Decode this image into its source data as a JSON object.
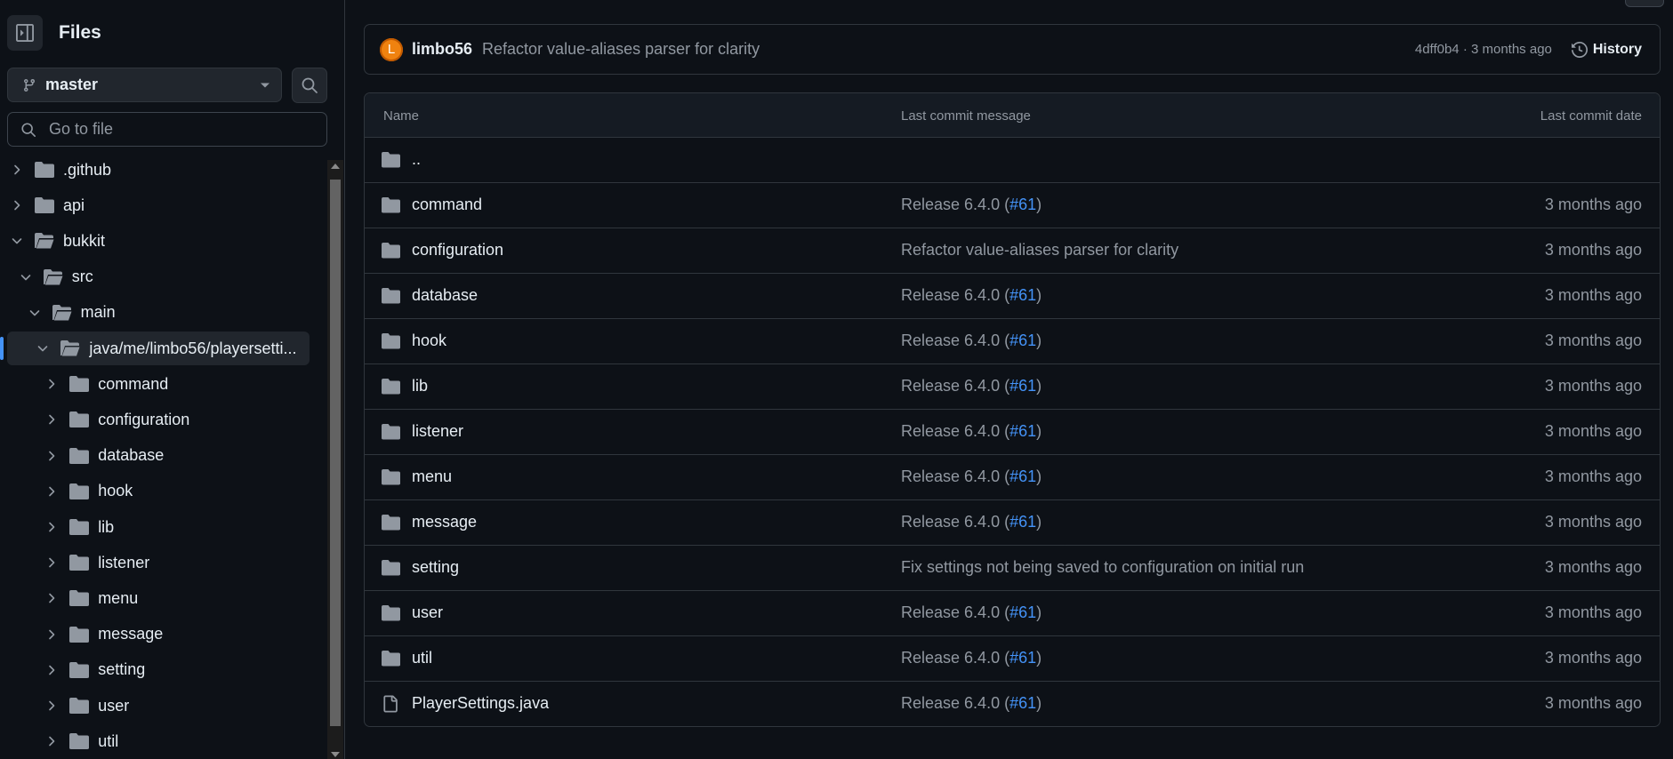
{
  "sidebar": {
    "title": "Files",
    "branch": "master",
    "goto_placeholder": "Go to file",
    "tree": [
      {
        "name": ".github",
        "depth": 0,
        "expanded": false,
        "selected": false
      },
      {
        "name": "api",
        "depth": 0,
        "expanded": false,
        "selected": false
      },
      {
        "name": "bukkit",
        "depth": 0,
        "expanded": true,
        "selected": false
      },
      {
        "name": "src",
        "depth": 1,
        "expanded": true,
        "selected": false
      },
      {
        "name": "main",
        "depth": 2,
        "expanded": true,
        "selected": false
      },
      {
        "name": "java/me/limbo56/playersetti...",
        "depth": 3,
        "expanded": true,
        "selected": true
      },
      {
        "name": "command",
        "depth": 4,
        "expanded": false,
        "selected": false
      },
      {
        "name": "configuration",
        "depth": 4,
        "expanded": false,
        "selected": false
      },
      {
        "name": "database",
        "depth": 4,
        "expanded": false,
        "selected": false
      },
      {
        "name": "hook",
        "depth": 4,
        "expanded": false,
        "selected": false
      },
      {
        "name": "lib",
        "depth": 4,
        "expanded": false,
        "selected": false
      },
      {
        "name": "listener",
        "depth": 4,
        "expanded": false,
        "selected": false
      },
      {
        "name": "menu",
        "depth": 4,
        "expanded": false,
        "selected": false
      },
      {
        "name": "message",
        "depth": 4,
        "expanded": false,
        "selected": false
      },
      {
        "name": "setting",
        "depth": 4,
        "expanded": false,
        "selected": false
      },
      {
        "name": "user",
        "depth": 4,
        "expanded": false,
        "selected": false
      },
      {
        "name": "util",
        "depth": 4,
        "expanded": false,
        "selected": false
      }
    ]
  },
  "commit": {
    "avatar_letter": "L",
    "author": "limbo56",
    "message": "Refactor value-aliases parser for clarity",
    "meta": "4dff0b4 · 3 months ago",
    "history_label": "History"
  },
  "table": {
    "headers": {
      "name": "Name",
      "message": "Last commit message",
      "date": "Last commit date"
    },
    "parent_label": "..",
    "rows": [
      {
        "name": "command",
        "type": "folder",
        "msg": "Release 6.4.0 (",
        "pr": "#61",
        "msg_end": ")",
        "date": "3 months ago"
      },
      {
        "name": "configuration",
        "type": "folder",
        "msg": "Refactor value-aliases parser for clarity",
        "pr": "",
        "msg_end": "",
        "date": "3 months ago"
      },
      {
        "name": "database",
        "type": "folder",
        "msg": "Release 6.4.0 (",
        "pr": "#61",
        "msg_end": ")",
        "date": "3 months ago"
      },
      {
        "name": "hook",
        "type": "folder",
        "msg": "Release 6.4.0 (",
        "pr": "#61",
        "msg_end": ")",
        "date": "3 months ago"
      },
      {
        "name": "lib",
        "type": "folder",
        "msg": "Release 6.4.0 (",
        "pr": "#61",
        "msg_end": ")",
        "date": "3 months ago"
      },
      {
        "name": "listener",
        "type": "folder",
        "msg": "Release 6.4.0 (",
        "pr": "#61",
        "msg_end": ")",
        "date": "3 months ago"
      },
      {
        "name": "menu",
        "type": "folder",
        "msg": "Release 6.4.0 (",
        "pr": "#61",
        "msg_end": ")",
        "date": "3 months ago"
      },
      {
        "name": "message",
        "type": "folder",
        "msg": "Release 6.4.0 (",
        "pr": "#61",
        "msg_end": ")",
        "date": "3 months ago"
      },
      {
        "name": "setting",
        "type": "folder",
        "msg": "Fix settings not being saved to configuration on initial run",
        "pr": "",
        "msg_end": "",
        "date": "3 months ago"
      },
      {
        "name": "user",
        "type": "folder",
        "msg": "Release 6.4.0 (",
        "pr": "#61",
        "msg_end": ")",
        "date": "3 months ago"
      },
      {
        "name": "util",
        "type": "folder",
        "msg": "Release 6.4.0 (",
        "pr": "#61",
        "msg_end": ")",
        "date": "3 months ago"
      },
      {
        "name": "PlayerSettings.java",
        "type": "file",
        "msg": "Release 6.4.0 (",
        "pr": "#61",
        "msg_end": ")",
        "date": "3 months ago"
      }
    ]
  },
  "colors": {
    "background": "#0d1117",
    "accent": "#4493f8",
    "avatar": "#f0820f"
  }
}
